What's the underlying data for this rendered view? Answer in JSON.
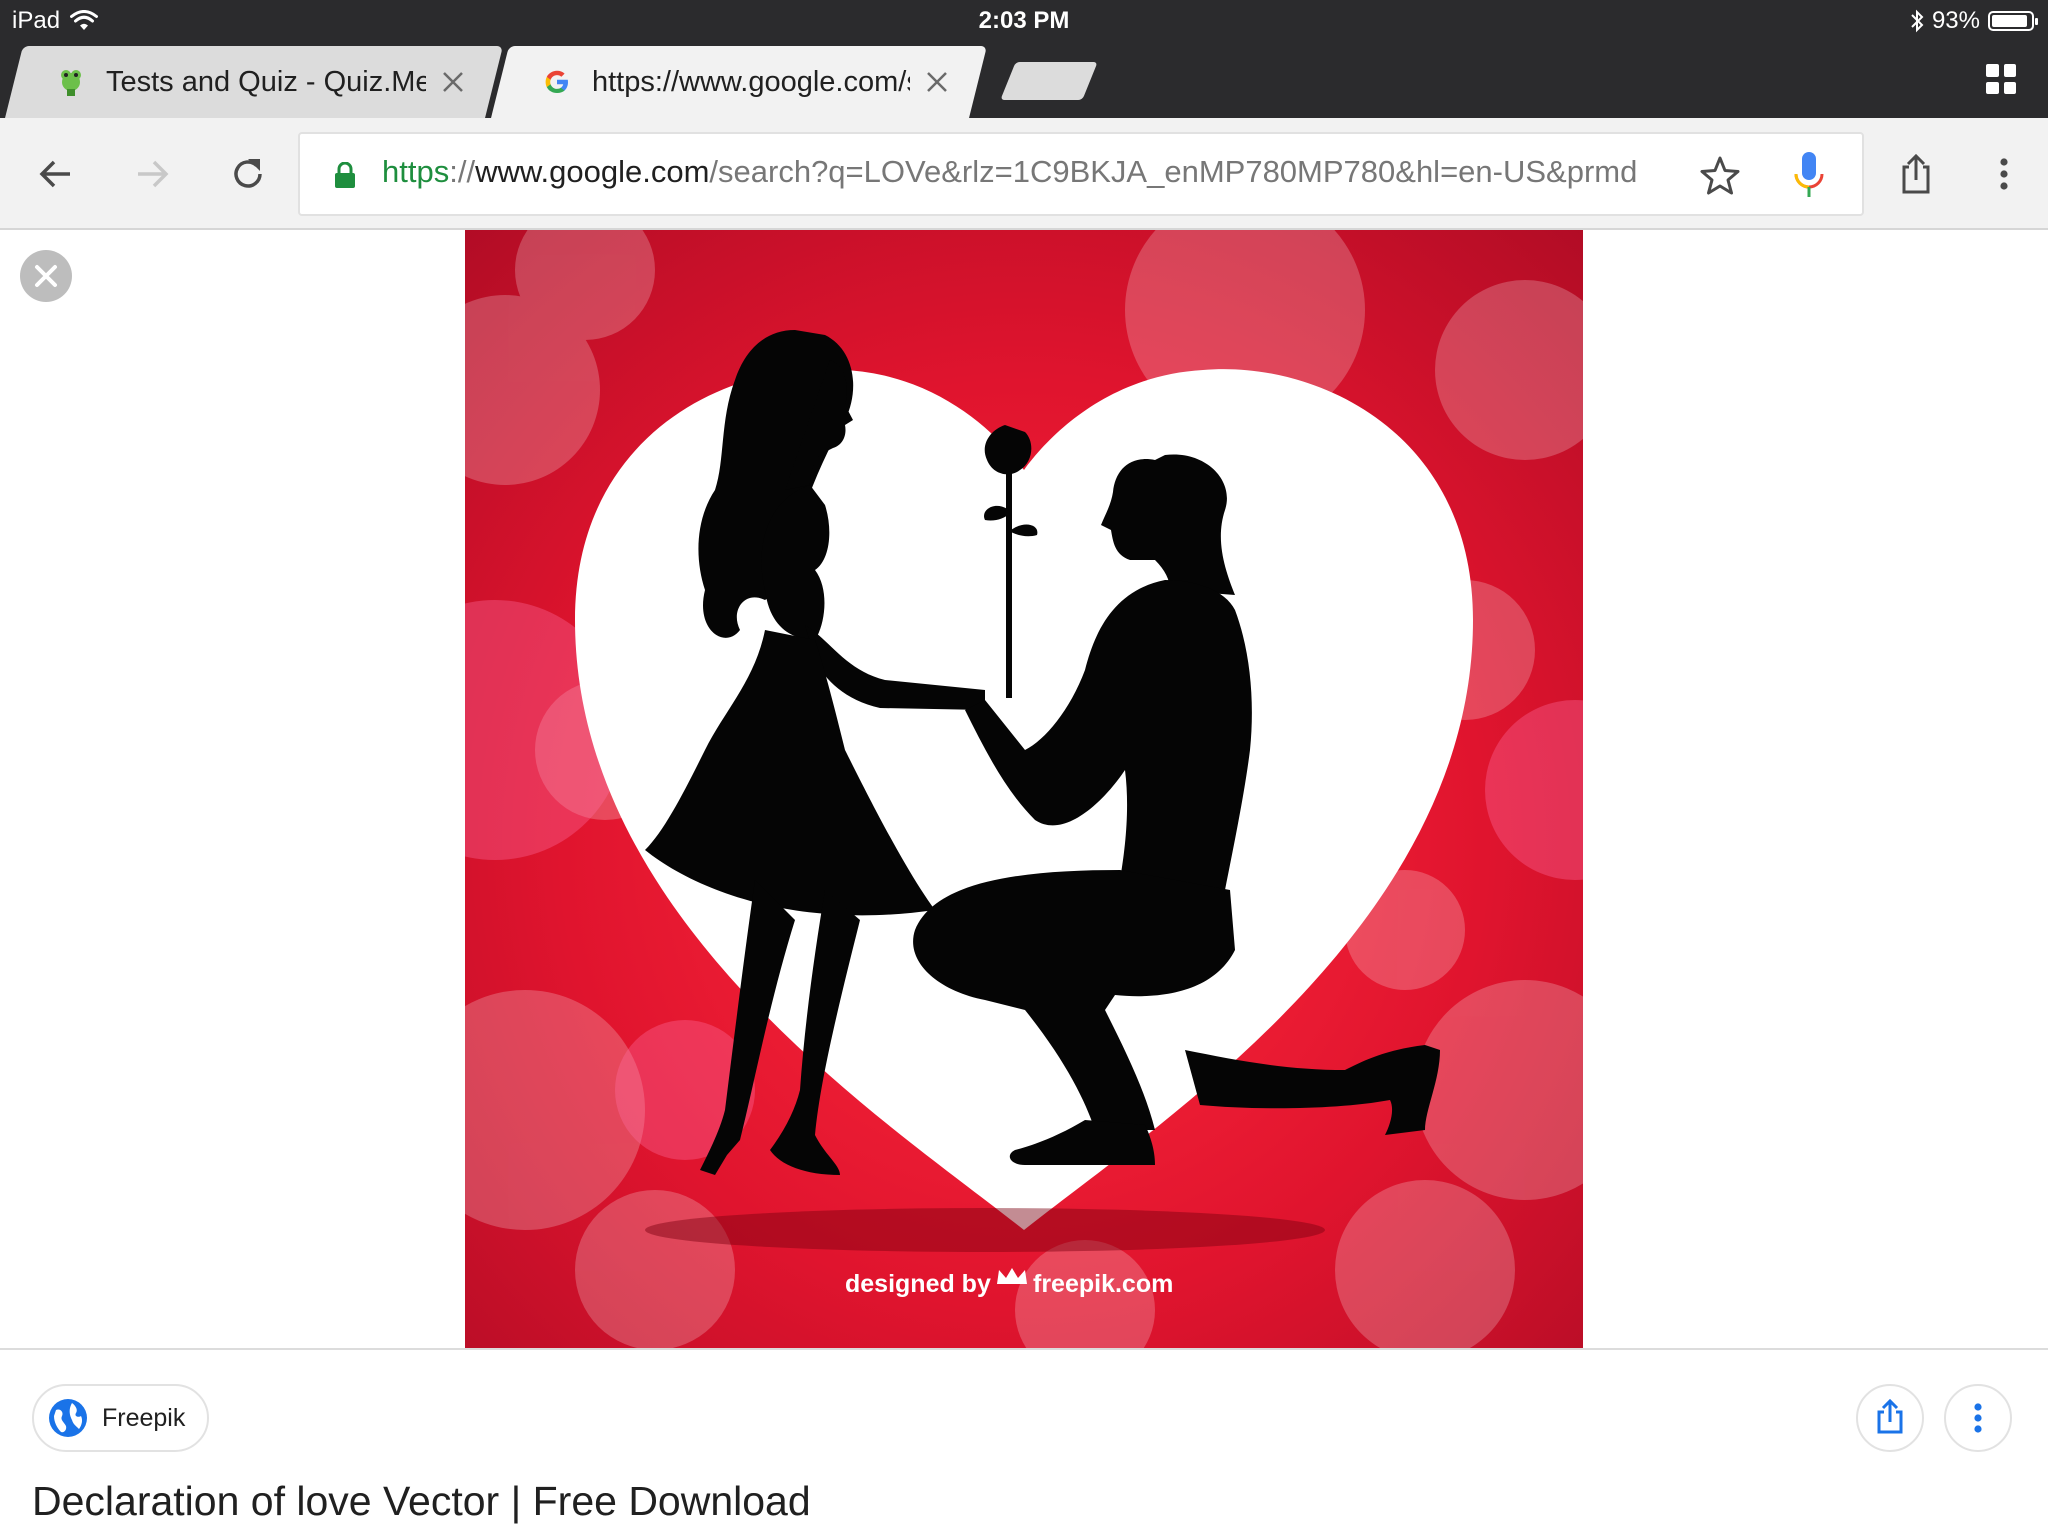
{
  "status_bar": {
    "device": "iPad",
    "time": "2:03 PM",
    "battery_text": "93%",
    "battery_level": 0.93
  },
  "tabs": [
    {
      "title": "Tests and Quiz - Quiz.Me",
      "active": false,
      "favicon": "quizme-frog-icon"
    },
    {
      "title": "https://www.google.com/se",
      "active": true,
      "favicon": "google-g-icon"
    }
  ],
  "toolbar": {
    "url_scheme": "https",
    "url_sep": "://",
    "url_host": "www.google.com",
    "url_path": "/search?q=LOVe&rlz=1C9BKJA_enMP780MP780&hl=en-US&prmd"
  },
  "image": {
    "watermark_prefix": "designed by",
    "watermark_site": "freepik.com"
  },
  "result": {
    "source_name": "Freepik",
    "title": "Declaration of love Vector | Free Download"
  },
  "colors": {
    "chrome_dark": "#2b2b2d",
    "accent_green": "#1e8e3e",
    "heart_red": "#e0142e"
  }
}
